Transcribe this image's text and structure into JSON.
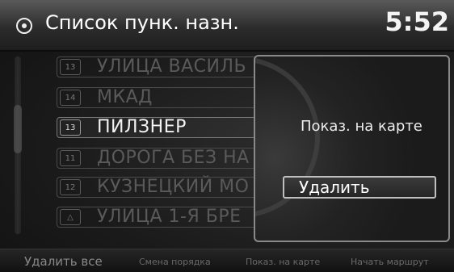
{
  "header": {
    "title": "Список пунк. назн.",
    "clock": "5:52",
    "icon": "navigation-compass-icon"
  },
  "list": {
    "items": [
      {
        "badge": "13",
        "label": "УЛИЦА ВАСИЛЬ",
        "active": false
      },
      {
        "badge": "14",
        "label": "МКАД",
        "active": false
      },
      {
        "badge": "13",
        "label": "ПИЛЗНЕР",
        "active": true
      },
      {
        "badge": "11",
        "label": "ДОРОГА БЕЗ НА",
        "active": false
      },
      {
        "badge": "12",
        "label": "КУЗНЕЦКИЙ МО",
        "active": false
      },
      {
        "badge": "△",
        "label": "УЛИЦА 1-Я БРЕ",
        "active": false
      }
    ]
  },
  "popup": {
    "show_on_map": "Показ. на карте",
    "delete": "Удалить"
  },
  "footer": {
    "delete_all": "Удалить все",
    "reorder": "Смена порядка",
    "show_on_map": "Показ. на карте",
    "start_route": "Начать маршрут"
  }
}
